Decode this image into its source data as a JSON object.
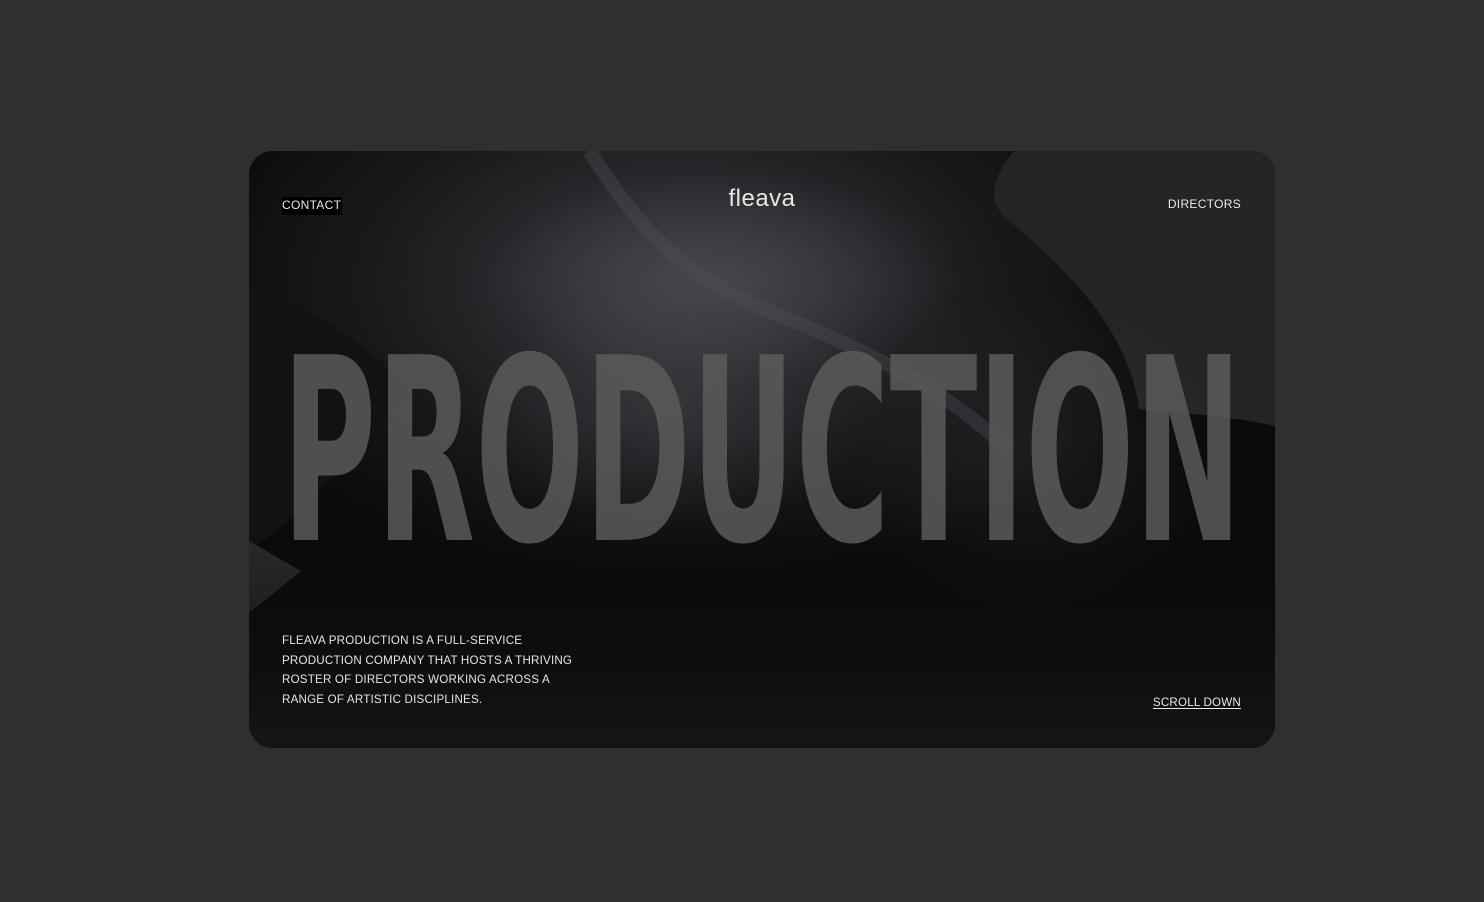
{
  "nav": {
    "contact_label": "CONTACT",
    "directors_label": "DIRECTORS"
  },
  "brand": {
    "logo_text": "fleava"
  },
  "hero": {
    "headline": "PRODUCTION",
    "description": "FLEAVA PRODUCTION IS A FULL-SERVICE PRODUCTION COMPANY THAT HOSTS A THRIVING ROSTER OF DIRECTORS WORKING ACROSS A RANGE OF ARTISTIC DISCIPLINES.",
    "scroll_label": "SCROLL DOWN"
  },
  "colors": {
    "page_background": "#2f2f2f",
    "card_background": "#0b0b0d",
    "headline_fill": "#5d5d5c",
    "text": "#e6e6e6"
  }
}
